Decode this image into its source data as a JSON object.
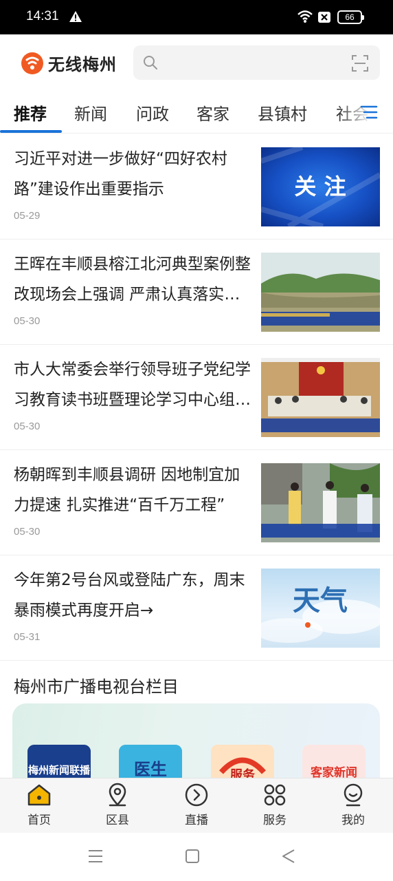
{
  "status_bar": {
    "time": "14:31",
    "battery": "66"
  },
  "header": {
    "logo_text": "无线梅州",
    "search_placeholder": ""
  },
  "tabs": [
    "推荐",
    "新闻",
    "问政",
    "客家",
    "县镇村",
    "社会"
  ],
  "news": [
    {
      "title": "习近平对进一步做好“四好农村路”建设作出重要指示",
      "date": "05-29",
      "thumb_caption": "关 注"
    },
    {
      "title": "王晖在丰顺县榕江北河典型案例整改现场会上强调 严肃认真落实整改",
      "date": "05-30"
    },
    {
      "title": "市人大常委会举行领导班子党纪学习教育读书班暨理论学习中心组学习",
      "date": "05-30"
    },
    {
      "title": "杨朝晖到丰顺县调研 因地制宜加力提速 扎实推进“百千万工程”",
      "date": "05-30"
    },
    {
      "title": "今年第2号台风或登陆广东，周末暴雨模式再度开启→",
      "date": "05-31",
      "thumb_caption": "天气"
    }
  ],
  "section": {
    "title": "梅州市广播电视台栏目"
  },
  "columns": [
    "梅州新闻联播",
    "医生",
    "服务",
    "客家新闻"
  ],
  "bottom_nav": [
    "首页",
    "区县",
    "直播",
    "服务",
    "我的"
  ],
  "colors": {
    "accent": "#1a73d9",
    "logo_orange": "#f05a22",
    "home_yellow": "#f4b400"
  }
}
